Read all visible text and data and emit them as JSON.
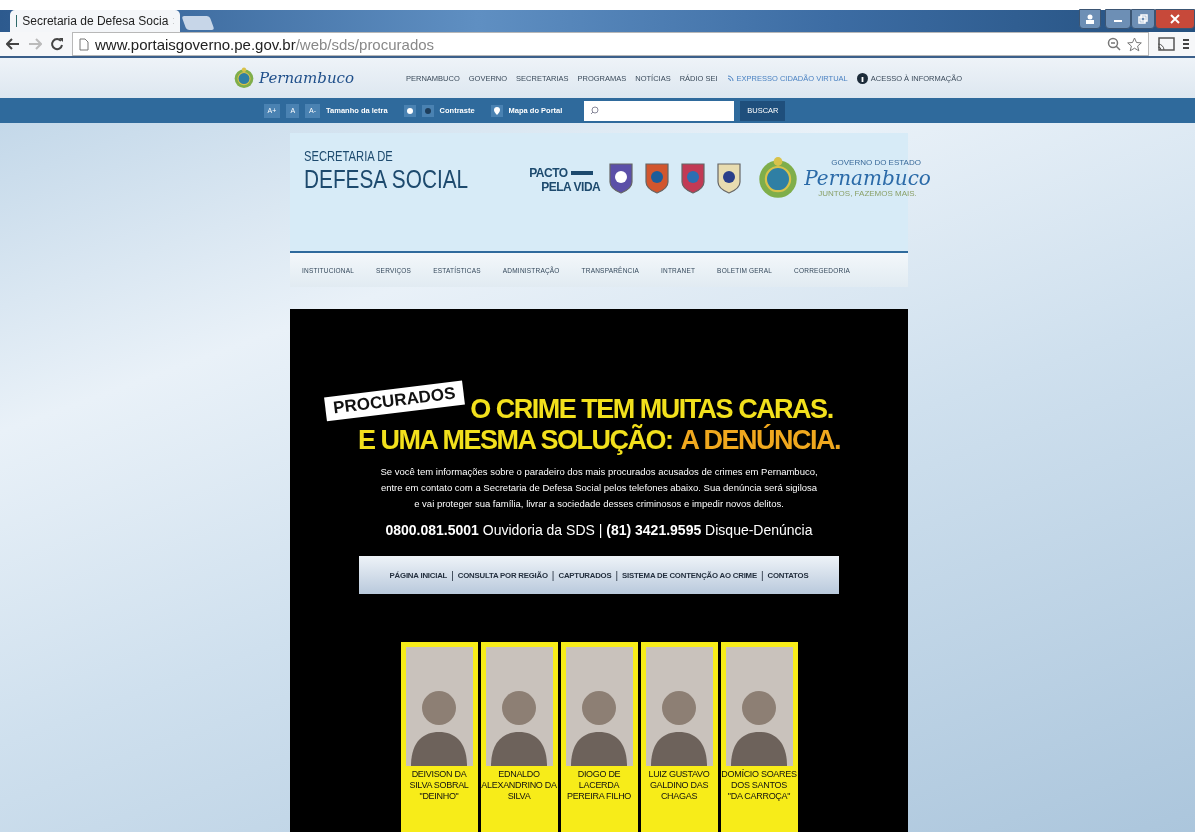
{
  "browser": {
    "tab_title": "Secretaria de Defesa Socia",
    "url_host": "www.portaisgoverno.pe.gov.br",
    "url_path": "/web/sds/procurados"
  },
  "portal_bar": {
    "logo_text": "Pernambuco",
    "links": [
      {
        "label": "PERNAMBUCO",
        "kind": "plain"
      },
      {
        "label": "GOVERNO",
        "kind": "plain"
      },
      {
        "label": "SECRETARIAS",
        "kind": "plain"
      },
      {
        "label": "PROGRAMAS",
        "kind": "plain"
      },
      {
        "label": "NOTÍCIAS",
        "kind": "plain"
      },
      {
        "label": "RÁDIO SEI",
        "kind": "plain"
      },
      {
        "label": "EXPRESSO CIDADÃO VIRTUAL",
        "kind": "feed"
      },
      {
        "label": "ACESSO À INFORMAÇÃO",
        "kind": "info"
      }
    ]
  },
  "accessibility_bar": {
    "font_buttons": [
      "A+",
      "A",
      "A-"
    ],
    "font_label": "Tamanho da letra",
    "contrast_label": "Contraste",
    "map_label": "Mapa do Portal",
    "search_button": "BUSCAR"
  },
  "header": {
    "title_small": "SECRETARIA DE",
    "title_large": "DEFESA SOCIAL",
    "pacto_line1": "PACTO",
    "pacto_line2": "PELA VIDA",
    "gov_caption": "GOVERNO DO ESTADO",
    "gov_name": "Pernambuco",
    "gov_slogan": "JUNTOS, FAZEMOS MAIS."
  },
  "main_menu": [
    "INSTITUCIONAL",
    "SERVIÇOS",
    "ESTATÍSTICAS",
    "ADMINISTRAÇÃO",
    "TRANSPARÊNCIA",
    "INTRANET",
    "BOLETIM GERAL",
    "CORREGEDORIA"
  ],
  "banner": {
    "tag": "PROCURADOS",
    "headline_1": "O CRIME TEM MUITAS CARAS.",
    "headline_2": "E UMA MESMA SOLUÇÃO:",
    "headline_2_highlight": "A DENÚNCIA.",
    "description": "Se você tem informações sobre o paradeiro dos mais procurados acusados de crimes em Pernambuco, entre em contato com a Secretaria de Defesa Social pelos telefones abaixo. Sua denúncia será sigilosa e vai proteger sua família, livrar a sociedade desses criminosos e impedir novos delitos.",
    "phones": "**0800.081.5001** Ouvidoria da SDS | **(81) 3421.9595** Disque-Denúncia"
  },
  "section_nav": {
    "separator": "|",
    "links": [
      "PÁGINA INICIAL",
      "CONSULTA POR REGIÃO",
      "CAPTURADOS",
      "SISTEMA DE CONTENÇÃO AO CRIME",
      "CONTATOS"
    ]
  },
  "wanted": [
    {
      "name_lines": [
        "DEIVISON DA",
        "SILVA SOBRAL",
        "\"DEINHO\""
      ]
    },
    {
      "name_lines": [
        "EDNALDO",
        "ALEXANDRINO DA",
        "SILVA"
      ]
    },
    {
      "name_lines": [
        "DIOGO DE",
        "LACERDA",
        "PEREIRA FILHO"
      ]
    },
    {
      "name_lines": [
        "LUIZ GUSTAVO",
        "GALDINO DAS",
        "CHAGAS"
      ]
    },
    {
      "name_lines": [
        "DOMÍCIO SOARES",
        "DOS SANTOS",
        "\"DA CARROÇA\""
      ]
    }
  ]
}
